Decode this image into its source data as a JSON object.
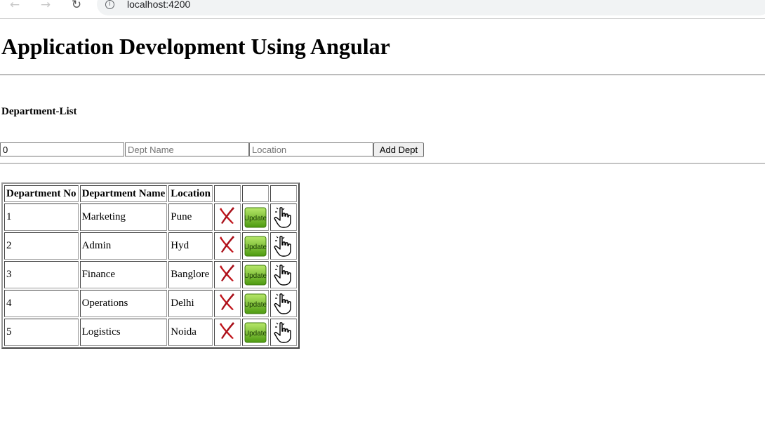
{
  "browser": {
    "url": "localhost:4200"
  },
  "page": {
    "title": "Application Development Using Angular",
    "section_title": "Department-List"
  },
  "form": {
    "dept_no_value": "0",
    "dept_name_placeholder": "Dept Name",
    "location_placeholder": "Location",
    "add_button_label": "Add Dept"
  },
  "table": {
    "headers": [
      "Department No",
      "Department Name",
      "Location",
      "",
      "",
      ""
    ],
    "rows": [
      {
        "no": "1",
        "name": "Marketing",
        "location": "Pune"
      },
      {
        "no": "2",
        "name": "Admin",
        "location": "Hyd"
      },
      {
        "no": "3",
        "name": "Finance",
        "location": "Banglore"
      },
      {
        "no": "4",
        "name": "Operations",
        "location": "Delhi"
      },
      {
        "no": "5",
        "name": "Logistics",
        "location": "Noida"
      }
    ],
    "row_actions": {
      "delete_icon": "delete-x-icon",
      "update_icon": "update-icon",
      "update_label": "Update",
      "select_icon": "hand-pointer-icon"
    }
  },
  "colors": {
    "delete_red": "#c0141b",
    "update_green": "#6fc21a"
  }
}
